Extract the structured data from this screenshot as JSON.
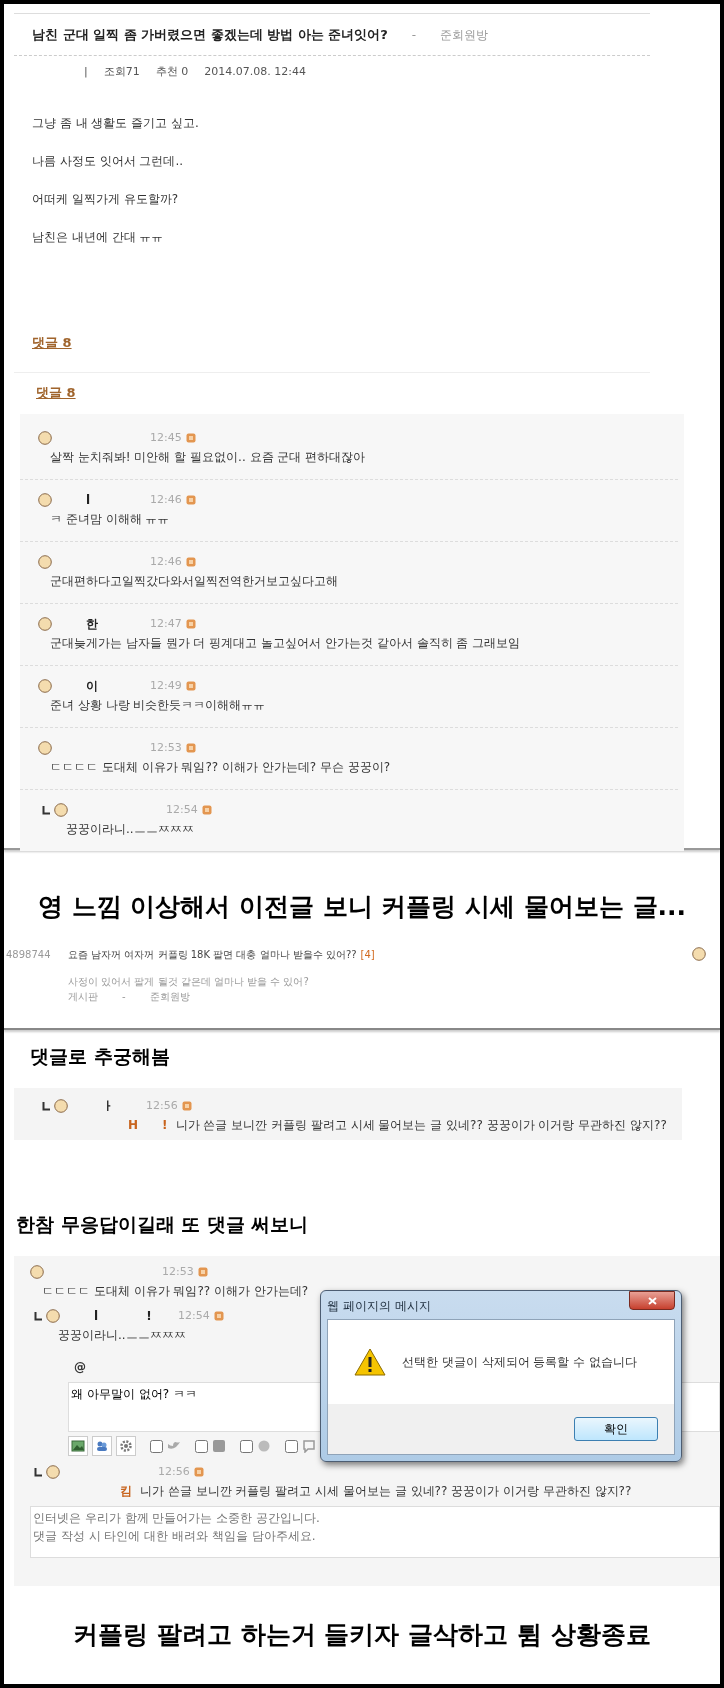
{
  "post": {
    "title": "남친 군대 일찍 좀 가버렸으면 좋겠는데 방법 아는 준녀잇어?",
    "separator": "-",
    "board": "준회원방",
    "meta": [
      "|",
      "조회71",
      "추천 0",
      "2014.07.08. 12:44"
    ],
    "body": [
      "그냥 좀 내 생활도 즐기고 싶고.",
      "나름 사정도 잇어서 그런데..",
      "어떠케 일찍가게 유도할까?",
      "남친은 내년에 간대 ㅠㅠ"
    ],
    "comment_links": [
      "댓글 8",
      "댓글 8"
    ]
  },
  "comments": [
    {
      "kind": "comment",
      "time": "12:45",
      "text": "살짝 눈치줘봐! 미안해 할 필요없이.. 요즘 군대 편하대잖아"
    },
    {
      "kind": "comment",
      "author_parts": [
        "l"
      ],
      "time": "12:46",
      "text": "ㅋ 준녀맘 이해해 ㅠㅠ"
    },
    {
      "kind": "comment",
      "time": "12:46",
      "text": "군대편하다고일찍갔다와서일찍전역한거보고싶다고해"
    },
    {
      "kind": "comment",
      "author_parts": [
        "한"
      ],
      "time": "12:47",
      "text": "군대늦게가는 남자들 뭔가 더 핑계대고 놀고싶어서 안가는것 같아서 솔직히 좀 그래보임"
    },
    {
      "kind": "comment",
      "author_parts": [
        "이"
      ],
      "time": "12:49",
      "text": "준녀 상황 나랑 비슷한듯ㅋㅋ이해해ㅠㅠ"
    },
    {
      "kind": "comment",
      "time": "12:53",
      "text": "ㄷㄷㄷㄷ 도대체 이유가 뭐임?? 이해가 안가는데? 무슨 꿍꿍이?"
    },
    {
      "kind": "reply",
      "time": "12:54",
      "text": "꿍꿍이라니..ㅡㅡㅉㅉㅉ"
    }
  ],
  "caption_1": "영 느낌 이상해서 이전글 보니 커플링 시세 물어보는 글...",
  "previous_post": {
    "number": "4898744",
    "title": "요즘 남자꺼 여자꺼 커플링 18K 팔면 대충 얼마나 받을수 있어??",
    "comment_count": "[4]",
    "preview": "사정이 있어서 팔게 될것 같은데 얼마나 받을 수 있어?",
    "board_label": "게시판",
    "separator": "-",
    "board": "준회원방"
  },
  "caption_2": "댓글로 추궁해봄",
  "probe_comment": {
    "kind": "reply",
    "author_parts": [
      "ㅏ"
    ],
    "time": "12:56",
    "mention_parts": [
      "H",
      "!"
    ],
    "text": "니가 쓴글 보니깐 커플링 팔려고 시세 물어보는 글 있네?? 꿍꿍이가 이거랑 무관하진 않지??"
  },
  "caption_3": "한참 무응답이길래 또 댓글 써보니",
  "thread": [
    {
      "kind": "comment",
      "time": "12:53",
      "text": "ㄷㄷㄷㄷ 도대체 이유가 뭐임?? 이해가 안가는데?"
    },
    {
      "kind": "reply",
      "author_parts": [
        "l",
        "!"
      ],
      "time": "12:54",
      "text": "꿍꿍이라니..ㅡㅡㅉㅉㅉ"
    }
  ],
  "reply_form": {
    "mention": "@",
    "value": "왜 아무말이 없어? ㅋㅋ",
    "tools": [
      {
        "kind": "image"
      },
      {
        "kind": "people"
      },
      {
        "kind": "gear"
      }
    ],
    "share": [
      {
        "kind": "bird",
        "checked": false
      },
      {
        "kind": "social",
        "checked": false
      },
      {
        "kind": "circle",
        "checked": false
      },
      {
        "kind": "speech",
        "checked": false
      }
    ]
  },
  "last_reply": {
    "kind": "reply",
    "time": "12:56",
    "mention_parts": [
      "킴"
    ],
    "text": "니가 쓴글 보니깐 커플링 팔려고 시세 물어보는 글 있네?? 꿍꿍이가 이거랑 무관하진 않지??"
  },
  "new_comment": {
    "placeholder": "인터넷은 우리가 함께 만들어가는 소중한 공간입니다.\n댓글 작성 시 타인에 대한 배려와 책임을 담아주세요."
  },
  "dialog": {
    "title": "웹 페이지의 메시지",
    "message": "선택한 댓글이 삭제되어 등록할 수 없습니다",
    "button": "확인"
  },
  "caption_4": "커플링 팔려고 하는거 들키자 글삭하고 튐 상황종료"
}
